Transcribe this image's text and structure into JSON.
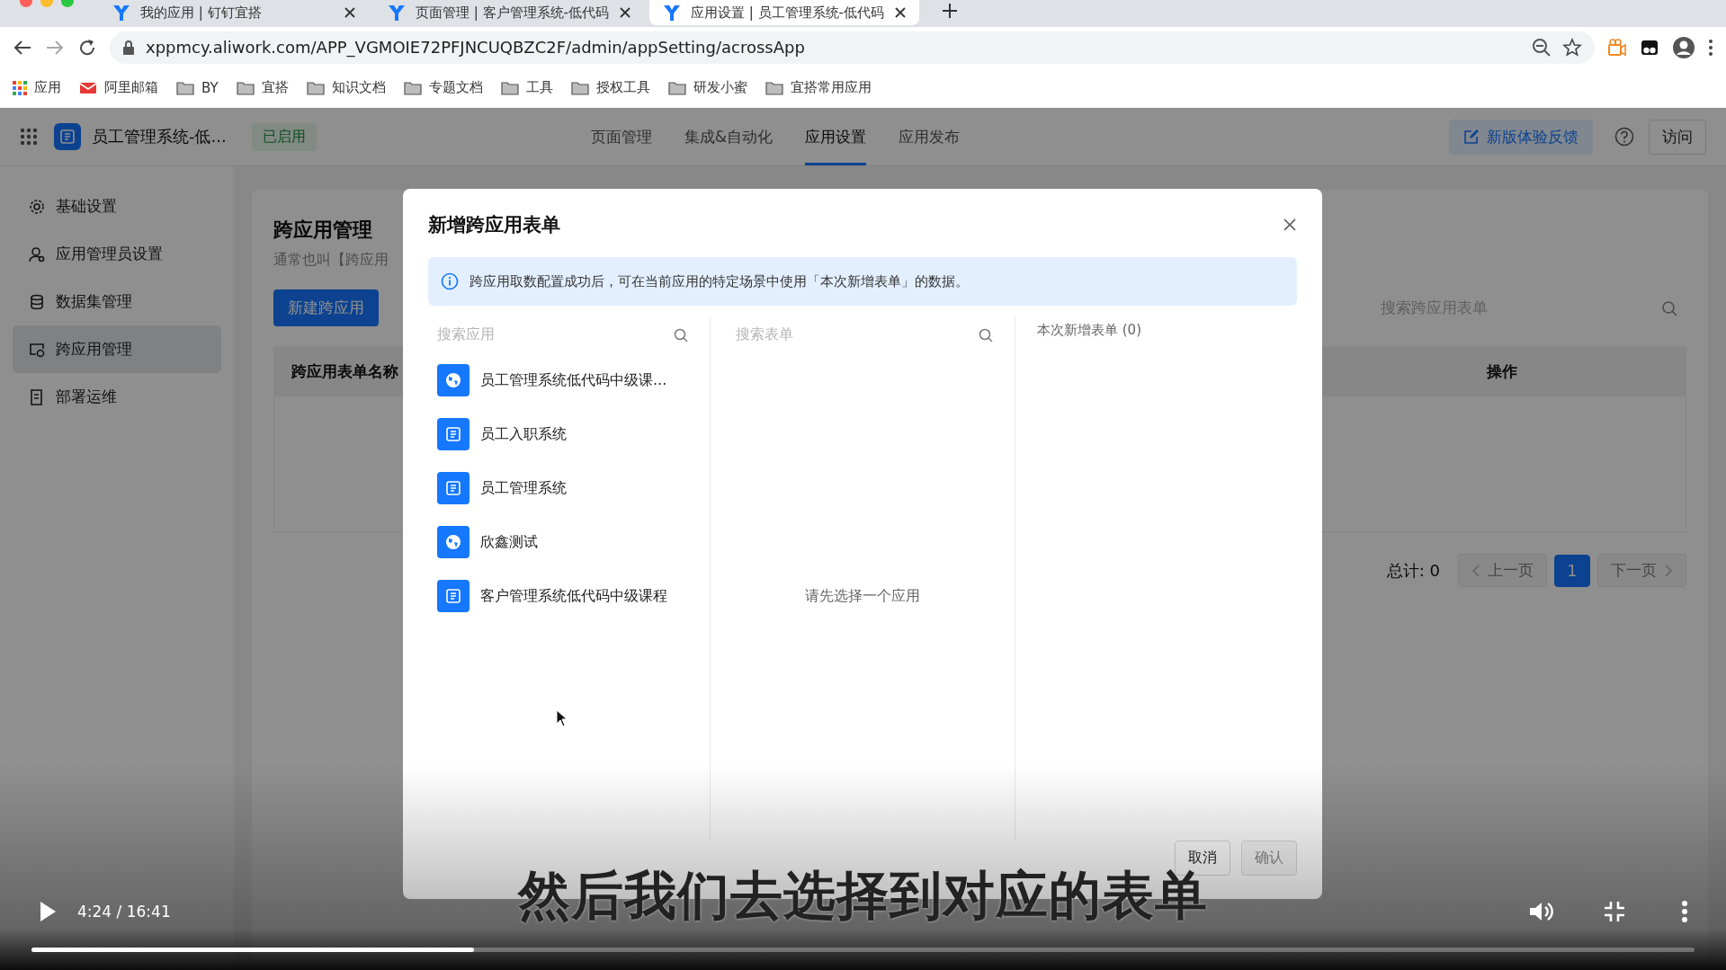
{
  "browser": {
    "tabs": [
      {
        "title": "我的应用 | 钉钉宜搭",
        "selected": false
      },
      {
        "title": "页面管理 | 客户管理系统-低代码",
        "selected": false
      },
      {
        "title": "应用设置 | 员工管理系统-低代码",
        "selected": true
      }
    ],
    "url": "xppmcy.aliwork.com/APP_VGMOIE72PFJNCUQBZC2F/admin/appSetting/acrossApp",
    "bookmarks": [
      {
        "label": "应用",
        "kind": "apps"
      },
      {
        "label": "阿里邮箱",
        "kind": "mail"
      },
      {
        "label": "BY",
        "kind": "folder"
      },
      {
        "label": "宜搭",
        "kind": "folder"
      },
      {
        "label": "知识文档",
        "kind": "folder"
      },
      {
        "label": "专题文档",
        "kind": "folder"
      },
      {
        "label": "工具",
        "kind": "folder"
      },
      {
        "label": "授权工具",
        "kind": "folder"
      },
      {
        "label": "研发小蜜",
        "kind": "folder"
      },
      {
        "label": "宜搭常用应用",
        "kind": "folder"
      }
    ]
  },
  "app": {
    "name": "员工管理系统-低...",
    "status": "已启用",
    "nav": [
      {
        "label": "页面管理",
        "selected": false
      },
      {
        "label": "集成&自动化",
        "selected": false
      },
      {
        "label": "应用设置",
        "selected": true
      },
      {
        "label": "应用发布",
        "selected": false
      }
    ],
    "feedback": "新版体验反馈",
    "visit": "访问"
  },
  "sidebar": [
    {
      "label": "基础设置",
      "kind": "gear",
      "selected": false
    },
    {
      "label": "应用管理员设置",
      "kind": "user",
      "selected": false
    },
    {
      "label": "数据集管理",
      "kind": "database",
      "selected": false
    },
    {
      "label": "跨应用管理",
      "kind": "cross",
      "selected": true
    },
    {
      "label": "部署运维",
      "kind": "deploy",
      "selected": false
    }
  ],
  "page": {
    "title": "跨应用管理",
    "subtitle": "通常也叫【跨应用",
    "new_button": "新建跨应用",
    "search_placeholder": "搜索跨应用表单",
    "columns": [
      "跨应用表单名称",
      "操作"
    ],
    "total": "总计: 0",
    "prev": "上一页",
    "pages": [
      {
        "label": "1",
        "selected": true
      }
    ],
    "next": "下一页"
  },
  "modal": {
    "title": "新增跨应用表单",
    "info": "跨应用取数配置成功后，可在当前应用的特定场景中使用「本次新增表单」的数据。",
    "app_search_placeholder": "搜索应用",
    "apps": [
      {
        "name": "员工管理系统低代码中级课...",
        "kind": "globe"
      },
      {
        "name": "员工入职系统",
        "kind": "form"
      },
      {
        "name": "员工管理系统",
        "kind": "form"
      },
      {
        "name": "欣鑫测试",
        "kind": "globe"
      },
      {
        "name": "客户管理系统低代码中级课程",
        "kind": "form"
      }
    ],
    "form_search_placeholder": "搜索表单",
    "empty": "请先选择一个应用",
    "selected_title": "本次新增表单 (0)",
    "cancel": "取消",
    "confirm": {
      "label": "确认",
      "disabled": true
    }
  },
  "player": {
    "time": "4:24 / 16:41",
    "level": 0.266,
    "caption": "然后我们去选择到对应的表单"
  }
}
